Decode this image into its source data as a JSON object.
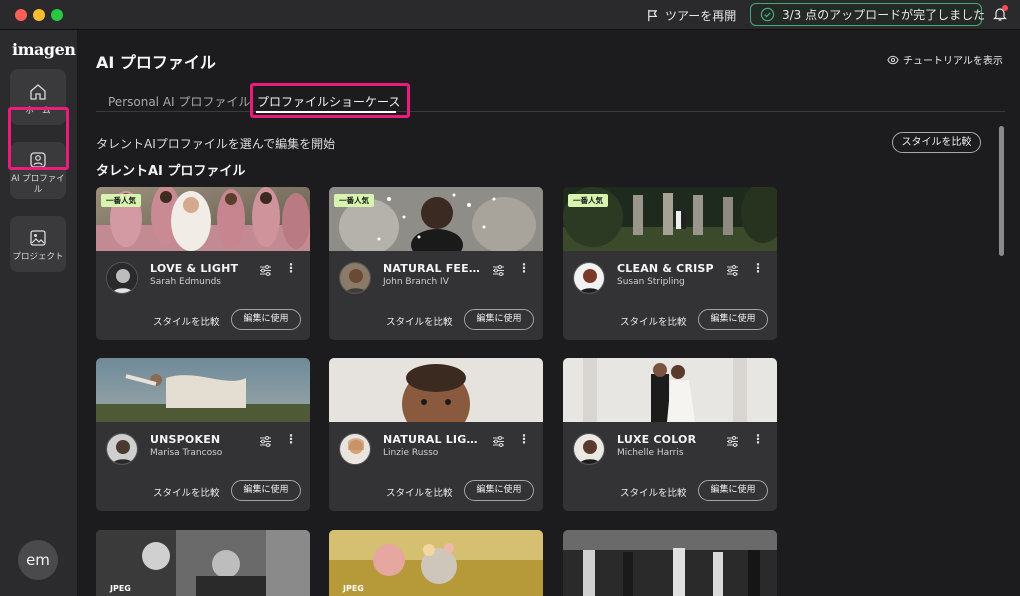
{
  "titlebar": {
    "tour_label": "ツアーを再開",
    "upload_status": "3/3 点のアップロードが完了しました"
  },
  "sidebar": {
    "logo": "imagen",
    "items": [
      {
        "label": "ホーム",
        "icon": "home-icon"
      },
      {
        "label": "AI プロファイル",
        "icon": "ai-profile-icon"
      },
      {
        "label": "プロジェクト",
        "icon": "project-icon"
      }
    ],
    "user_initials": "em"
  },
  "main": {
    "page_title": "AI プロファイル",
    "tutorial_label": "チュートリアルを表示",
    "tabs": [
      {
        "label": "Personal AI プロファイル",
        "active": false
      },
      {
        "label": "プロファイルショーケース",
        "active": true
      }
    ],
    "subtitle": "タレントAIプロファイルを選んで編集を開始",
    "compare_styles_label": "スタイルを比較",
    "section_title": "タレントAI プロファイル"
  },
  "cards": [
    {
      "title": "LOVE & LIGHT",
      "author": "Sarah Edmunds",
      "badge": "一番人気",
      "compare": "スタイルを比較",
      "edit": "編集に使用",
      "more": "⋮"
    },
    {
      "title": "NATURAL FEELS",
      "author": "John Branch IV",
      "badge": "一番人気",
      "compare": "スタイルを比較",
      "edit": "編集に使用",
      "more": "⋮"
    },
    {
      "title": "CLEAN & CRISP",
      "author": "Susan Stripling",
      "badge": "一番人気",
      "compare": "スタイルを比較",
      "edit": "編集に使用",
      "more": "⋮"
    },
    {
      "title": "UNSPOKEN",
      "author": "Marisa Trancoso",
      "compare": "スタイルを比較",
      "edit": "編集に使用",
      "more": "⋮"
    },
    {
      "title": "NATURAL LIGH…",
      "author": "Linzie Russo",
      "compare": "スタイルを比較",
      "edit": "編集に使用",
      "more": "⋮"
    },
    {
      "title": "LUXE COLOR",
      "author": "Michelle Harris",
      "compare": "スタイルを比較",
      "edit": "編集に使用",
      "more": "⋮"
    }
  ],
  "bottom_row": [
    {
      "tag": "JPEG"
    },
    {
      "tag": "JPEG"
    },
    {
      "tag": ""
    }
  ],
  "colors": {
    "accent_highlight": "#ee1a7d",
    "badge_bg": "#d8f5b0",
    "upload_border": "#4aa77a"
  }
}
